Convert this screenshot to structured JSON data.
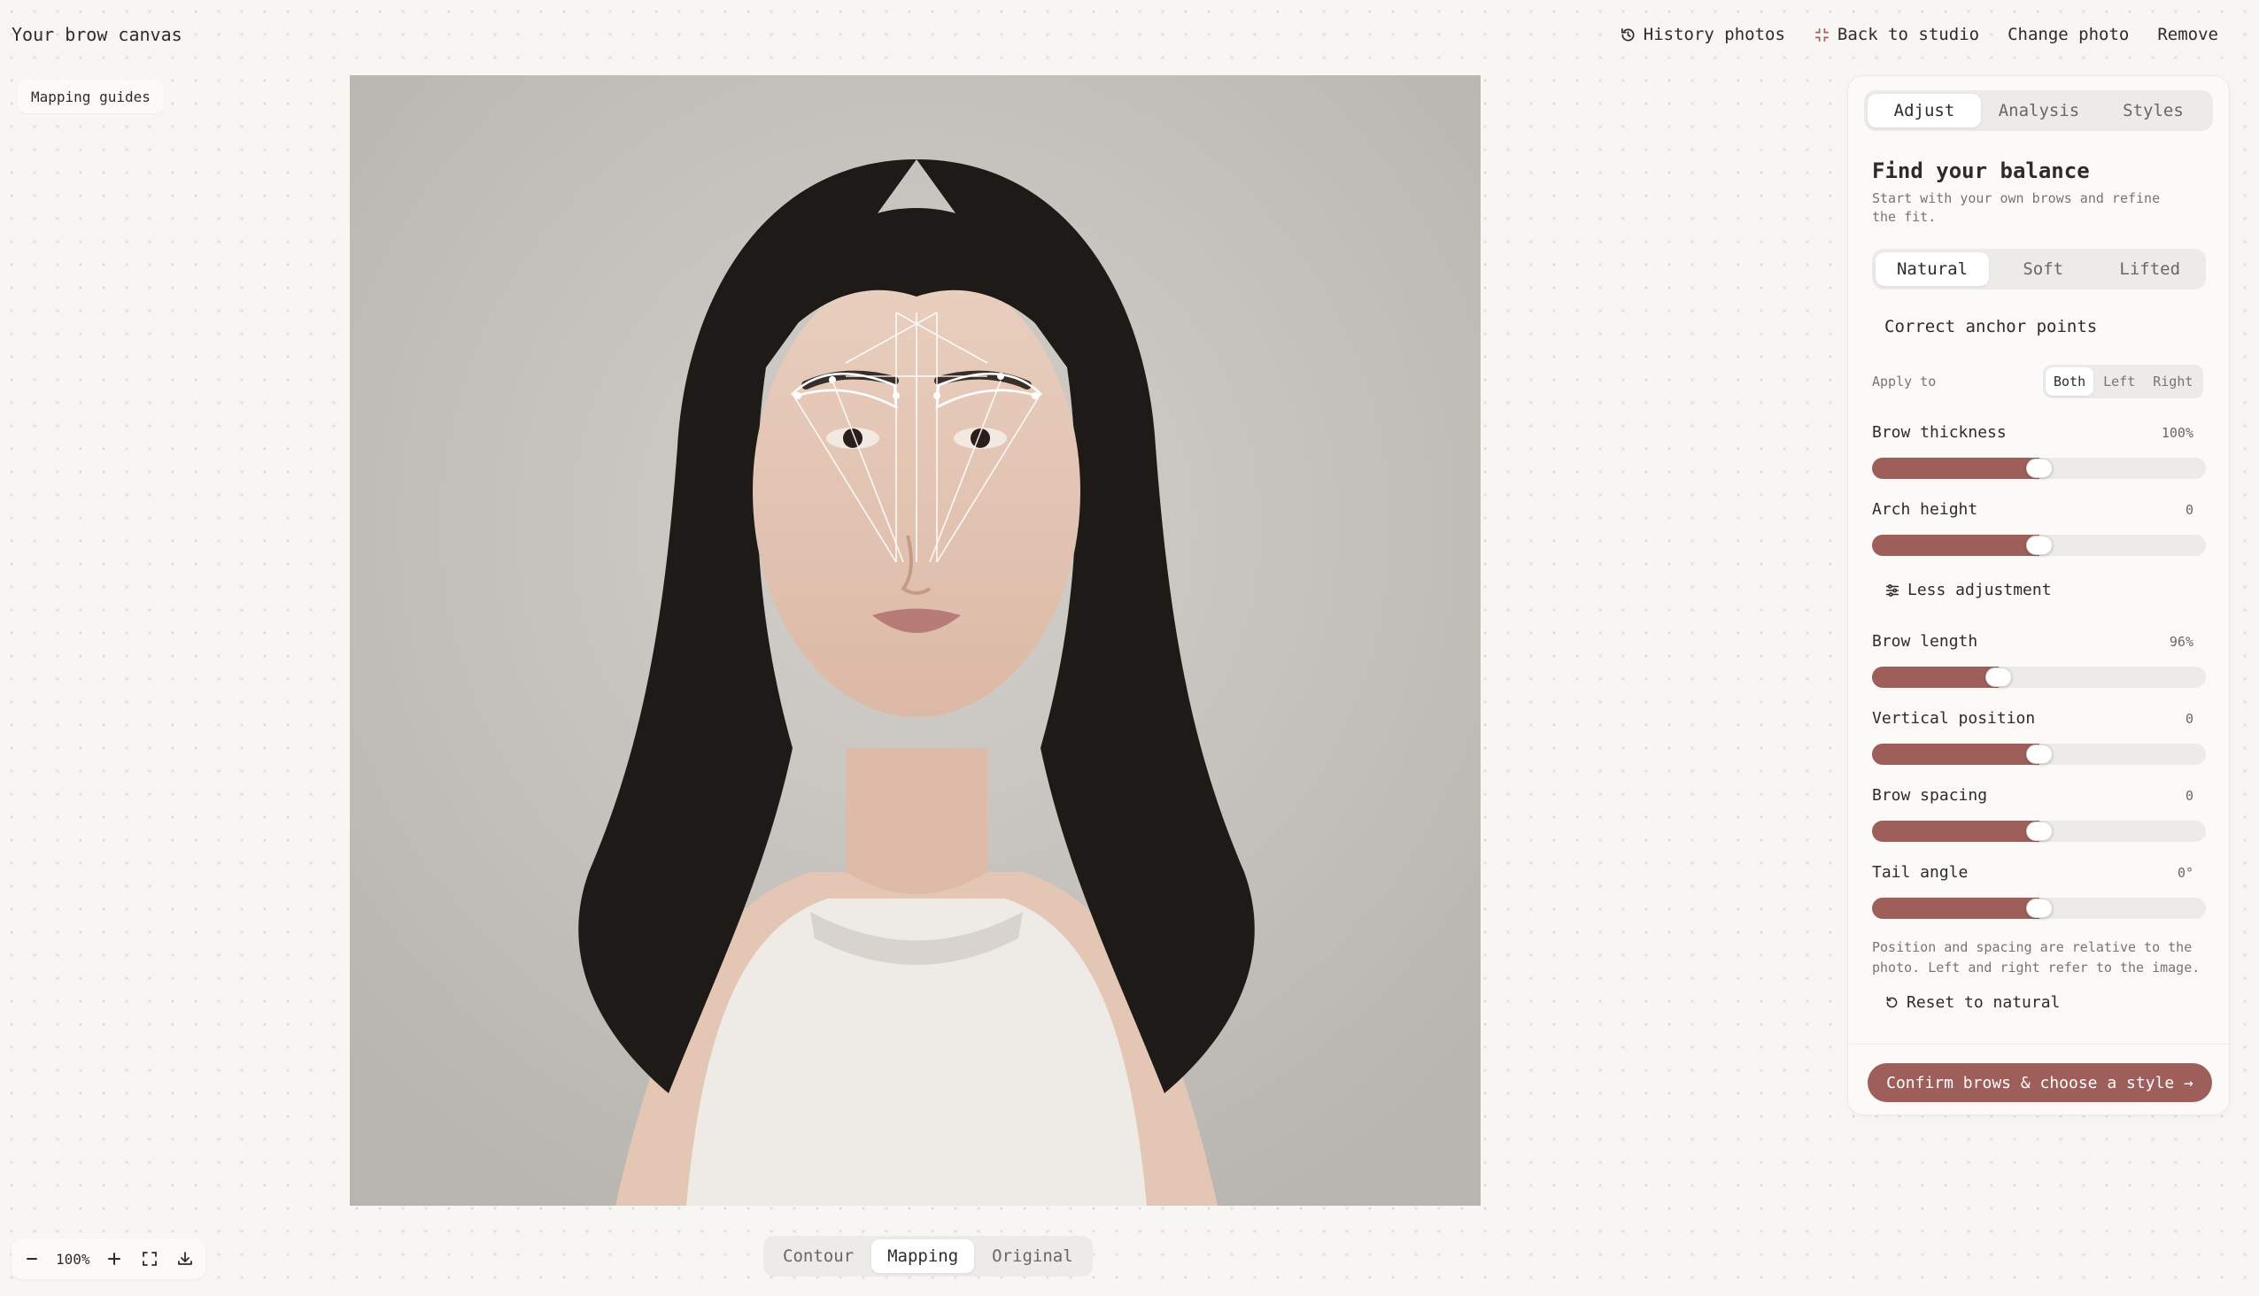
{
  "app": {
    "title": "Your brow canvas"
  },
  "top_actions": [
    {
      "label": "History photos",
      "icon": "history-icon"
    },
    {
      "label": "Back to studio",
      "icon": "collapse-icon"
    },
    {
      "label": "Change photo"
    },
    {
      "label": "Remove"
    }
  ],
  "canvas": {
    "guides_label": "Mapping guides"
  },
  "view_modes": {
    "items": [
      "Contour",
      "Mapping",
      "Original"
    ],
    "active": "Mapping"
  },
  "zoom": {
    "value": "100%"
  },
  "panel": {
    "tabs": [
      "Adjust",
      "Analysis",
      "Styles"
    ],
    "active_tab": "Adjust",
    "title": "Find your balance",
    "subtitle": "Start with your own brows and refine the fit.",
    "variants": [
      "Natural",
      "Soft",
      "Lifted"
    ],
    "active_variant": "Natural",
    "anchor_label": "Correct anchor points",
    "apply_to": {
      "label": "Apply to",
      "options": [
        "Both",
        "Left",
        "Right"
      ],
      "active": "Both"
    },
    "sliders_top": [
      {
        "label": "Brow thickness",
        "value": "100%",
        "level": 0.5
      },
      {
        "label": "Arch height",
        "value": "0",
        "level": 0.5
      }
    ],
    "less_adjustment": "Less adjustment",
    "sliders_bottom": [
      {
        "label": "Brow length",
        "value": "96%",
        "level": 0.38
      },
      {
        "label": "Vertical position",
        "value": "0",
        "level": 0.5
      },
      {
        "label": "Brow spacing",
        "value": "0",
        "level": 0.5
      },
      {
        "label": "Tail angle",
        "value": "0°",
        "level": 0.5
      }
    ],
    "note": "Position and spacing are relative to the photo. Left and right refer to the image.",
    "reset_label": "Reset to natural",
    "confirm_label": "Confirm brows & choose a style →"
  },
  "colors": {
    "accent": "#9e5e5a",
    "background": "#f7f6f3",
    "panel": "#fbfaf9"
  }
}
